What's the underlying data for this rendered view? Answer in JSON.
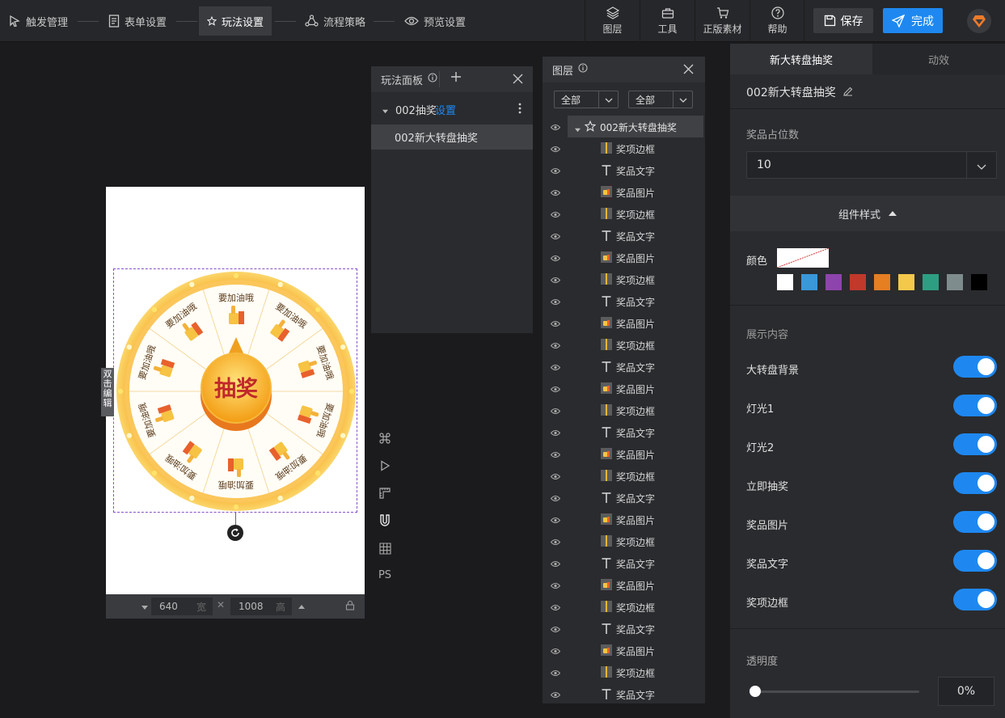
{
  "topbar": {
    "steps": [
      {
        "label": "触发管理",
        "icon": "pointer-icon"
      },
      {
        "label": "表单设置",
        "icon": "form-icon"
      },
      {
        "label": "玩法设置",
        "icon": "star-icon"
      },
      {
        "label": "流程策略",
        "icon": "flow-icon"
      },
      {
        "label": "预览设置",
        "icon": "eye-icon"
      }
    ],
    "active_step": "玩法设置",
    "tools": [
      {
        "label": "图层",
        "icon": "layers-icon"
      },
      {
        "label": "工具",
        "icon": "toolbox-icon"
      },
      {
        "label": "正版素材",
        "icon": "cart-icon"
      },
      {
        "label": "帮助",
        "icon": "help-icon"
      }
    ],
    "save_label": "保存",
    "done_label": "完成"
  },
  "canvas": {
    "side_tag": "双击编辑",
    "wheel": {
      "center_label": "抽奖",
      "segment_label": "要加油哦",
      "segments": 10
    },
    "footer": {
      "width": "640",
      "width_unit": "宽",
      "height": "1008",
      "height_unit": "高"
    }
  },
  "vertical_tools": [
    "command-icon",
    "play-icon",
    "ruler-icon",
    "magnet-icon",
    "grid-icon",
    "ps-icon"
  ],
  "vertical_tools_ps_label": "PS",
  "play_panel": {
    "title": "玩法面板",
    "group_label": "002抽奖",
    "group_link": "设置",
    "item_label": "002新大转盘抽奖"
  },
  "layer_panel": {
    "title": "图层",
    "filter1": "全部",
    "filter2": "全部",
    "root": "002新大转盘抽奖",
    "rows": [
      {
        "type": "frame",
        "label": "奖项边框"
      },
      {
        "type": "text",
        "label": "奖品文字"
      },
      {
        "type": "image",
        "label": "奖品图片"
      },
      {
        "type": "frame",
        "label": "奖项边框"
      },
      {
        "type": "text",
        "label": "奖品文字"
      },
      {
        "type": "image",
        "label": "奖品图片"
      },
      {
        "type": "frame",
        "label": "奖项边框"
      },
      {
        "type": "text",
        "label": "奖品文字"
      },
      {
        "type": "image",
        "label": "奖品图片"
      },
      {
        "type": "frame",
        "label": "奖项边框"
      },
      {
        "type": "text",
        "label": "奖品文字"
      },
      {
        "type": "image",
        "label": "奖品图片"
      },
      {
        "type": "frame",
        "label": "奖项边框"
      },
      {
        "type": "text",
        "label": "奖品文字"
      },
      {
        "type": "image",
        "label": "奖品图片"
      },
      {
        "type": "frame",
        "label": "奖项边框"
      },
      {
        "type": "text",
        "label": "奖品文字"
      },
      {
        "type": "image",
        "label": "奖品图片"
      },
      {
        "type": "frame",
        "label": "奖项边框"
      },
      {
        "type": "text",
        "label": "奖品文字"
      },
      {
        "type": "image",
        "label": "奖品图片"
      },
      {
        "type": "frame",
        "label": "奖项边框"
      },
      {
        "type": "text",
        "label": "奖品文字"
      },
      {
        "type": "image",
        "label": "奖品图片"
      },
      {
        "type": "frame",
        "label": "奖项边框"
      },
      {
        "type": "text",
        "label": "奖品文字"
      }
    ]
  },
  "right_panel": {
    "tab_active": "新大转盘抽奖",
    "tab_other": "动效",
    "component_name": "002新大转盘抽奖",
    "slots_label": "奖品占位数",
    "slots_value": "10",
    "style_section": "组件样式",
    "color_label": "颜色",
    "swatches": [
      "#ffffff",
      "#3a97d8",
      "#8e44ad",
      "#c0392b",
      "#e67e22",
      "#f4c84a",
      "#2e9e82",
      "#7f8c8d",
      "#000000"
    ],
    "display_section": "展示内容",
    "toggles": [
      {
        "label": "大转盘背景",
        "on": true
      },
      {
        "label": "灯光1",
        "on": true
      },
      {
        "label": "灯光2",
        "on": true
      },
      {
        "label": "立即抽奖",
        "on": true
      },
      {
        "label": "奖品图片",
        "on": true
      },
      {
        "label": "奖品文字",
        "on": true
      },
      {
        "label": "奖项边框",
        "on": true
      }
    ],
    "opacity_label": "透明度",
    "opacity_value": "0%"
  }
}
